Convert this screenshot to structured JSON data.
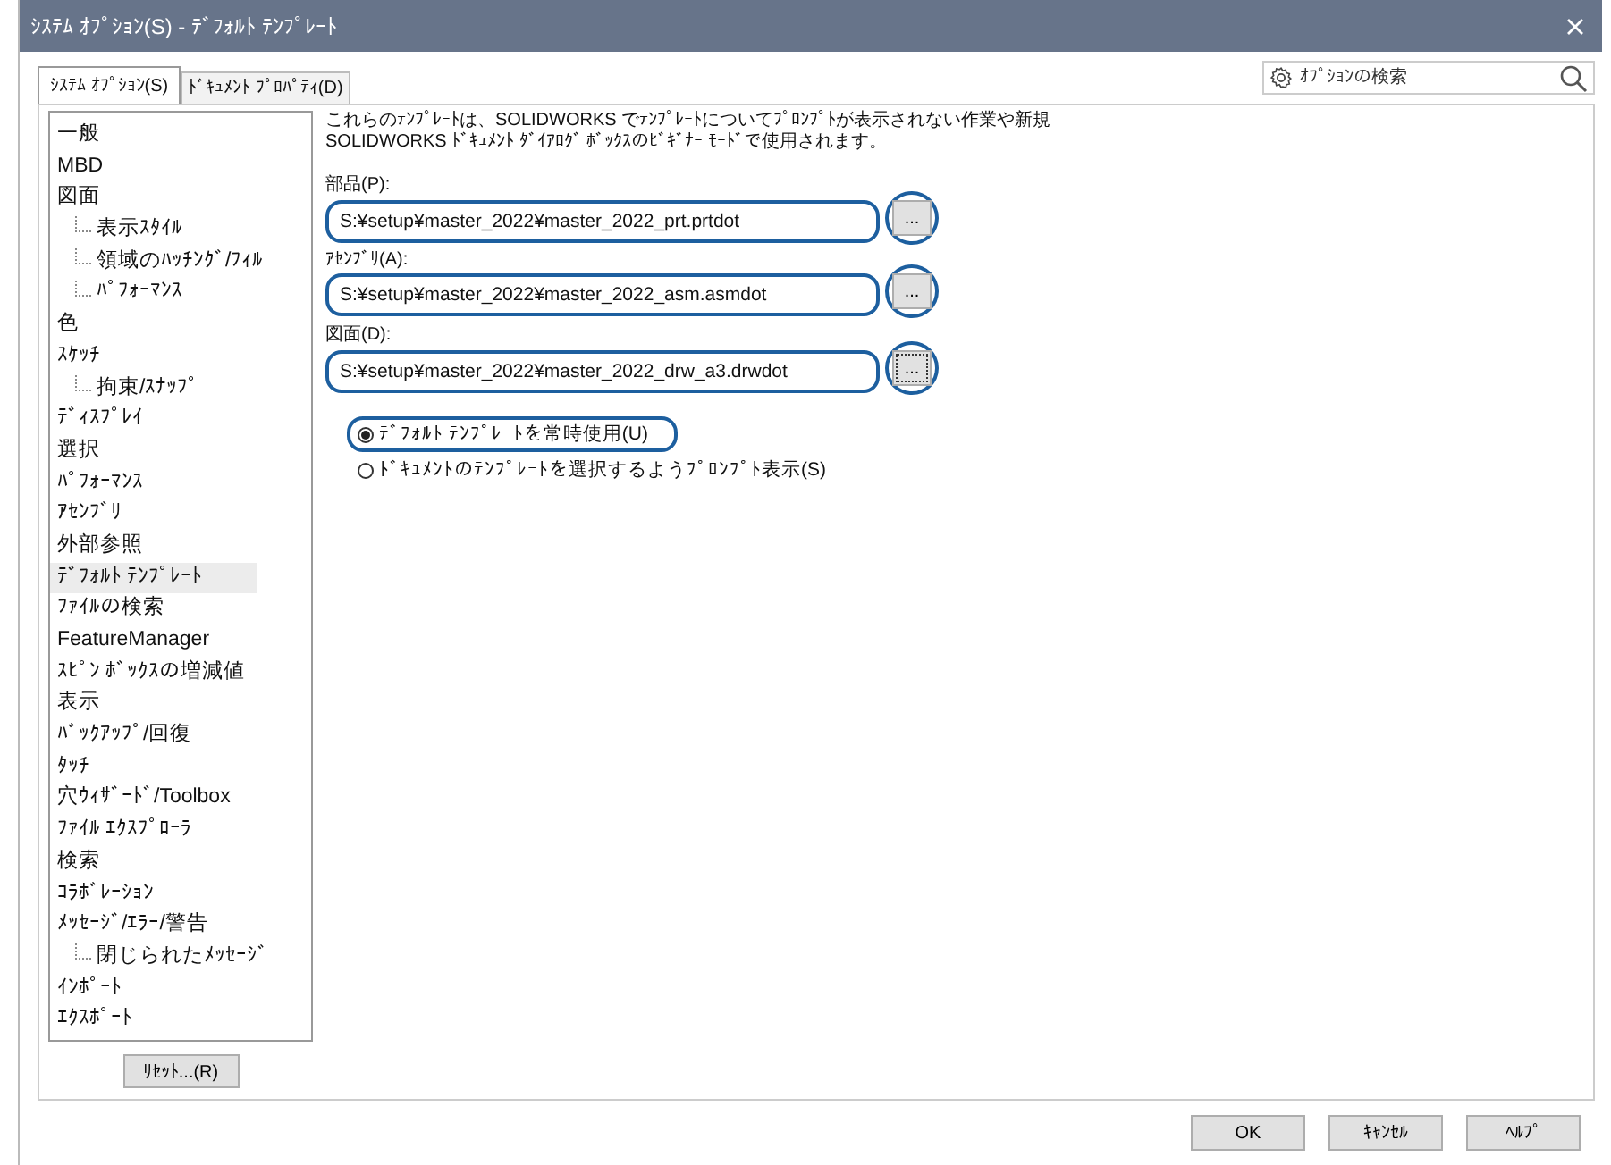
{
  "window": {
    "title": "ｼｽﾃﾑ ｵﾌﾟｼｮﾝ(S) - ﾃﾞﾌｫﾙﾄ ﾃﾝﾌﾟﾚｰﾄ"
  },
  "tabs": [
    {
      "label": "ｼｽﾃﾑ ｵﾌﾟｼｮﾝ(S)",
      "selected": true
    },
    {
      "label": "ﾄﾞｷｭﾒﾝﾄ ﾌﾟﾛﾊﾟﾃｨ(D)",
      "selected": false
    }
  ],
  "search": {
    "placeholder": "ｵﾌﾟｼｮﾝの検索"
  },
  "tree": [
    {
      "label": "一般",
      "selected": false
    },
    {
      "label": "MBD",
      "selected": false
    },
    {
      "label": "図面",
      "selected": false,
      "children": [
        {
          "label": "表示ｽﾀｲﾙ",
          "selected": false
        },
        {
          "label": "領域のﾊｯﾁﾝｸﾞ/ﾌｨﾙ",
          "selected": false
        },
        {
          "label": "ﾊﾟﾌｫｰﾏﾝｽ",
          "selected": false
        }
      ]
    },
    {
      "label": "色",
      "selected": false
    },
    {
      "label": "ｽｹｯﾁ",
      "selected": false,
      "children": [
        {
          "label": "拘束/ｽﾅｯﾌﾟ",
          "selected": false
        }
      ]
    },
    {
      "label": "ﾃﾞｨｽﾌﾟﾚｲ",
      "selected": false
    },
    {
      "label": "選択",
      "selected": false
    },
    {
      "label": "ﾊﾟﾌｫｰﾏﾝｽ",
      "selected": false
    },
    {
      "label": "ｱｾﾝﾌﾞﾘ",
      "selected": false
    },
    {
      "label": "外部参照",
      "selected": false
    },
    {
      "label": "ﾃﾞﾌｫﾙﾄ ﾃﾝﾌﾟﾚｰﾄ",
      "selected": true
    },
    {
      "label": "ﾌｧｲﾙの検索",
      "selected": false
    },
    {
      "label": "FeatureManager",
      "selected": false
    },
    {
      "label": "ｽﾋﾟﾝ ﾎﾞｯｸｽの増減値",
      "selected": false
    },
    {
      "label": "表示",
      "selected": false
    },
    {
      "label": "ﾊﾞｯｸｱｯﾌﾟ/回復",
      "selected": false
    },
    {
      "label": "ﾀｯﾁ",
      "selected": false
    },
    {
      "label": "穴ｳｨｻﾞｰﾄﾞ/Toolbox",
      "selected": false
    },
    {
      "label": "ﾌｧｲﾙ ｴｸｽﾌﾟﾛｰﾗ",
      "selected": false
    },
    {
      "label": "検索",
      "selected": false
    },
    {
      "label": "ｺﾗﾎﾞﾚｰｼｮﾝ",
      "selected": false
    },
    {
      "label": "ﾒｯｾｰｼﾞ/ｴﾗｰ/警告",
      "selected": false,
      "children": [
        {
          "label": "閉じられたﾒｯｾｰｼﾞ",
          "selected": false
        }
      ]
    },
    {
      "label": "ｲﾝﾎﾟｰﾄ",
      "selected": false
    },
    {
      "label": "ｴｸｽﾎﾟｰﾄ",
      "selected": false
    }
  ],
  "reset_button": "ﾘｾｯﾄ...(R)",
  "description": [
    "これらのﾃﾝﾌﾟﾚｰﾄは、SOLIDWORKS でﾃﾝﾌﾟﾚｰﾄについてﾌﾟﾛﾝﾌﾟﾄが表示されない作業や新規",
    "SOLIDWORKS ﾄﾞｷｭﾒﾝﾄ ﾀﾞｲｱﾛｸﾞ ﾎﾞｯｸｽのﾋﾞｷﾞﾅｰ ﾓｰﾄﾞで使用されます。"
  ],
  "templates": [
    {
      "label": "部品(P):",
      "value": "S:¥setup¥master_2022¥master_2022_prt.prtdot",
      "browse": "...",
      "highlighted": true
    },
    {
      "label": "ｱｾﾝﾌﾞﾘ(A):",
      "value": "S:¥setup¥master_2022¥master_2022_asm.asmdot",
      "browse": "...",
      "highlighted": true
    },
    {
      "label": "図面(D):",
      "value": "S:¥setup¥master_2022¥master_2022_drw_a3.drwdot",
      "browse": "...",
      "highlighted": true
    }
  ],
  "options": [
    {
      "label": "ﾃﾞﾌｫﾙﾄ ﾃﾝﾌﾟﾚｰﾄを常時使用(U)",
      "selected": true,
      "highlighted": true
    },
    {
      "label": "ﾄﾞｷｭﾒﾝﾄのﾃﾝﾌﾟﾚｰﾄを選択するようﾌﾟﾛﾝﾌﾟﾄ表示(S)",
      "selected": false,
      "highlighted": false
    }
  ],
  "buttons": [
    "OK",
    "ｷｬﾝｾﾙ",
    "ﾍﾙﾌﾟ"
  ]
}
